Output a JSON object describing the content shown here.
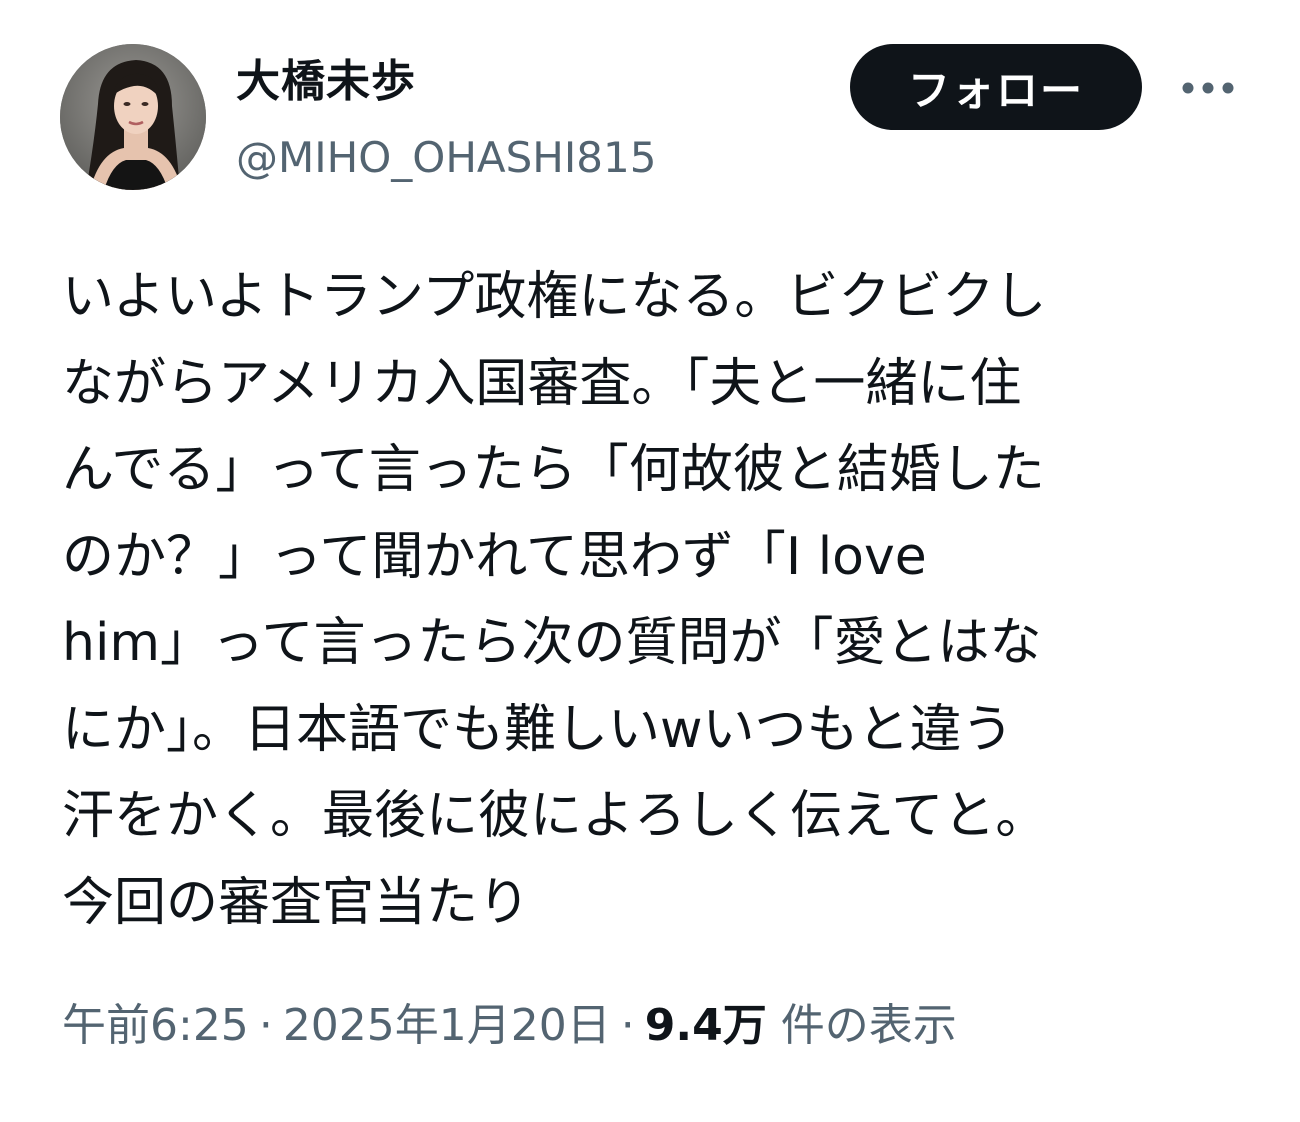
{
  "author": {
    "display_name": "大橋未歩",
    "handle": "@MIHO_OHASHI815",
    "avatar_icon": "profile-photo"
  },
  "header": {
    "follow_label": "フォロー",
    "more_icon": "more-dots-icon"
  },
  "tweet": {
    "lines": [
      "いよいよトランプ政権になる。ビクビクし",
      "ながらアメリカ入国審査。「夫と一緒に住",
      "んでる」って言ったら「何故彼と結婚した",
      "のか？」って聞かれて思わず「I love",
      "him」って言ったら次の質問が「愛とはな",
      "にか」。日本語でも難しいwいつもと違う",
      "汗をかく。最後に彼によろしく伝えてと。",
      "今回の審査官当たり"
    ]
  },
  "meta": {
    "time": "午前6:25",
    "separator": "·",
    "date": "2025年1月20日",
    "views_count": "9.4万",
    "views_label": "件の表示"
  },
  "colors": {
    "text": "#0f1419",
    "secondary": "#536471",
    "follow_bg": "#0f1419",
    "follow_text": "#ffffff",
    "background": "#ffffff"
  }
}
